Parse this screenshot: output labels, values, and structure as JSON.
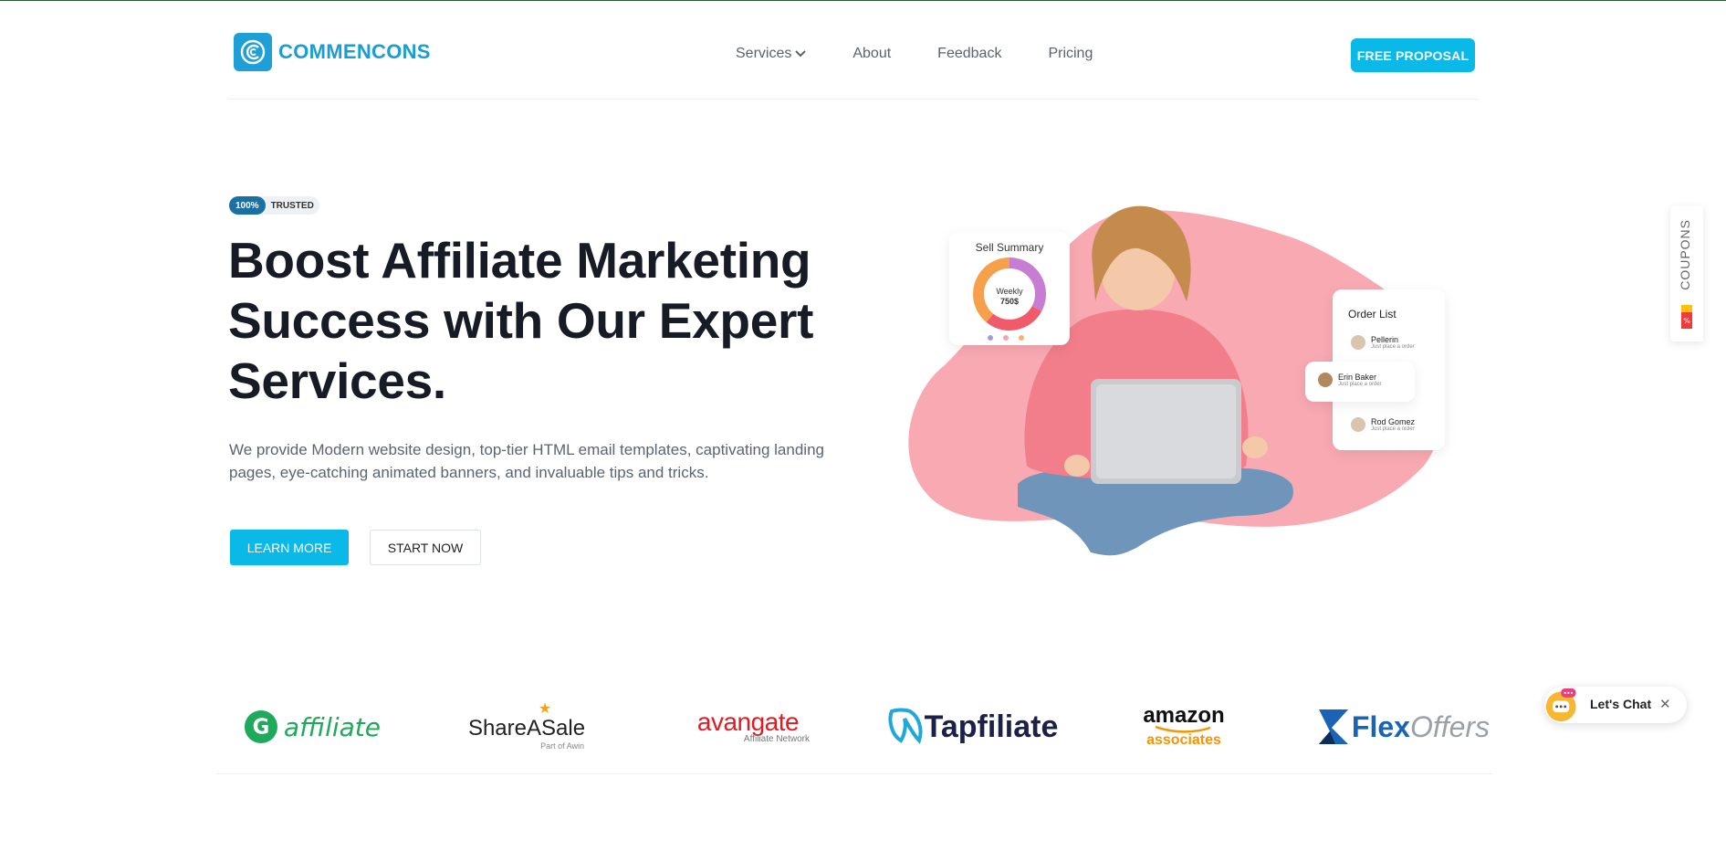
{
  "brand": {
    "name": "COMMENCONS",
    "color": "#1a9dd4"
  },
  "nav": {
    "items": [
      {
        "label": "Services",
        "has_dropdown": true
      },
      {
        "label": "About"
      },
      {
        "label": "Feedback"
      },
      {
        "label": "Pricing"
      }
    ],
    "cta_label": "FREE PROPOSAL"
  },
  "hero": {
    "badge_value": "100%",
    "badge_text": "TRUSTED",
    "title_lines": [
      "Boost Affiliate Marketing",
      "Success with Our Expert",
      "Services."
    ],
    "description_lines": [
      "We provide Modern website design, top-tier HTML email templates, captivating landing",
      "pages, eye-catching animated banners, and invaluable tips and tricks."
    ],
    "primary_button": "LEARN MORE",
    "secondary_button": "START NOW",
    "accent_color": "#0bb9e8"
  },
  "illustration": {
    "sell_summary": {
      "title": "Sell Summary",
      "center_label": "Weekly",
      "center_value": "750$"
    },
    "order_list": {
      "title": "Order List",
      "orders": [
        {
          "name": "Pellerin",
          "note": "Just place a order"
        },
        {
          "name": "Erin Baker",
          "note": "Just place a order"
        },
        {
          "name": "Rod Gomez",
          "note": "Just place a order"
        }
      ]
    }
  },
  "coupons_tab": {
    "label": "COUPONS"
  },
  "partners": [
    {
      "name": "affiliate",
      "icon": "cj-affiliate-logo"
    },
    {
      "name": "ShareASale",
      "subtitle": "Part of Awin",
      "icon": "shareasale-logo"
    },
    {
      "name": "avangate",
      "subtitle": "Affiliate Network",
      "icon": "avangate-logo"
    },
    {
      "name": "Tapfiliate",
      "icon": "tapfiliate-logo"
    },
    {
      "name": "amazon",
      "subtitle": "associates",
      "icon": "amazon-associates-logo"
    },
    {
      "name": "Flex",
      "name2": "Offers",
      "icon": "flexoffers-logo"
    }
  ],
  "chat": {
    "label": "Let's Chat",
    "close": "✕"
  }
}
